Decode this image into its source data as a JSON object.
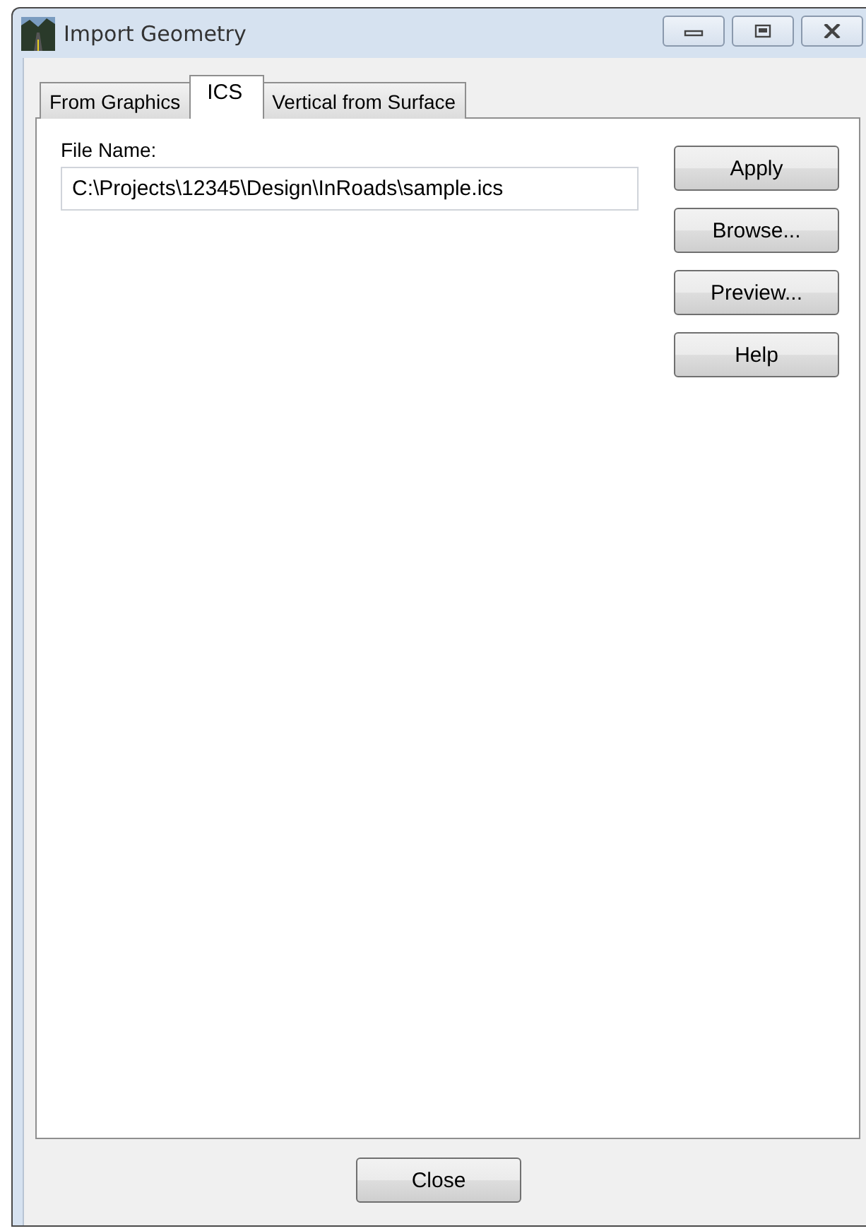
{
  "window": {
    "title": "Import Geometry"
  },
  "tabs": [
    {
      "label": "From Graphics",
      "selected": false
    },
    {
      "label": "ICS",
      "selected": true
    },
    {
      "label": "Vertical from Surface",
      "selected": false
    }
  ],
  "file_name": {
    "label": "File Name:",
    "value": "C:\\Projects\\12345\\Design\\InRoads\\sample.ics"
  },
  "buttons": [
    "Apply",
    "Browse...",
    "Preview...",
    "Help"
  ],
  "close_button": "Close"
}
